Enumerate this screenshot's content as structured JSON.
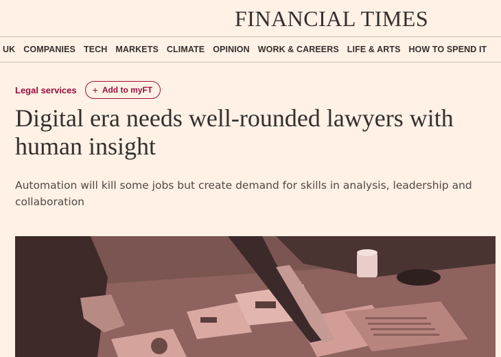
{
  "masthead": {
    "brand": "FINANCIAL TIMES"
  },
  "nav": {
    "items": [
      "UK",
      "COMPANIES",
      "TECH",
      "MARKETS",
      "CLIMATE",
      "OPINION",
      "WORK & CAREERS",
      "LIFE & ARTS",
      "HOW TO SPEND IT"
    ]
  },
  "article": {
    "topic": "Legal services",
    "myft_label": "Add to myFT",
    "myft_icon": "plus-icon",
    "headline": "Digital era needs well-rounded lawyers with human insight",
    "standfirst": "Automation will kill some jobs but create demand for skills in analysis, leadership and collaboration"
  },
  "colors": {
    "background": "#fff1e5",
    "accent": "#990f3d",
    "text": "#33302e",
    "image_tint": "#c98c85"
  }
}
